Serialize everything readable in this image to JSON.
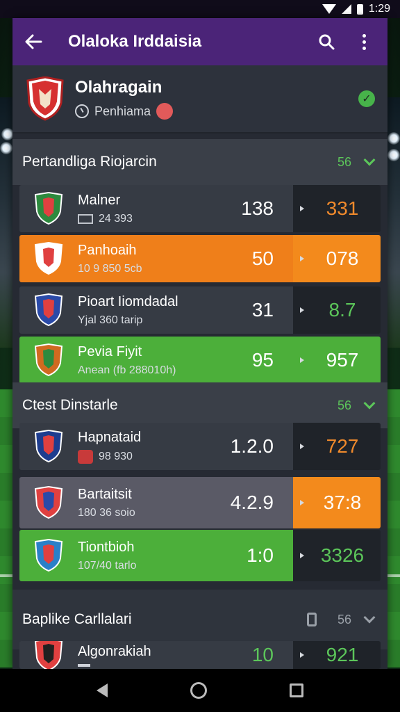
{
  "status_bar": {
    "time": "1:29"
  },
  "app_bar": {
    "title": "Olaloka Irddaisia"
  },
  "team_header": {
    "name": "Olahragain",
    "subtitle": "Penhiama"
  },
  "sections": [
    {
      "title": "Pertandliga Riojarcin",
      "count": "56",
      "rows": [
        {
          "name": "Malner",
          "sub": "24 393",
          "score": "138",
          "odds": "331",
          "style": "dark",
          "odds_color": "#f08a2c"
        },
        {
          "name": "Panhoaih",
          "sub": "10 9 850 5cb",
          "score": "50",
          "odds": "078",
          "style": "orange",
          "odds_color": "#ffffff"
        },
        {
          "name": "Pioart Iiomdadal",
          "sub": "Yjal 360 tarip",
          "score": "31",
          "odds": "8.7",
          "style": "dark",
          "odds_color": "#5cc65a"
        },
        {
          "name": "Pevia Fiyit",
          "sub": "Anean (fb 288010h)",
          "score": "95",
          "odds": "957",
          "style": "green",
          "odds_color": "#ffffff"
        }
      ]
    },
    {
      "title": "Ctest Dinstarle",
      "count": "56",
      "rows": [
        {
          "name": "Hapnataid",
          "sub": "98 930",
          "score": "1.2.0",
          "odds": "727",
          "style": "dark",
          "odds_color": "#f08a2c"
        },
        {
          "name": "Bartaitsit",
          "sub": "180 36 soio",
          "score": "4.2.9",
          "odds": "37:8",
          "style": "grey",
          "odds_color": "#ffffff"
        },
        {
          "name": "Tiontbioh",
          "sub": "107/40 tarlo",
          "score": "1:0",
          "odds": "3326",
          "style": "green",
          "odds_color": "#5cc65a"
        }
      ]
    },
    {
      "title": "Baplike Carllalari",
      "count": "56",
      "rows": [
        {
          "name": "Algonrakiah",
          "sub": "",
          "score": "10",
          "odds": "921",
          "style": "dark",
          "odds_color": "#5cc65a"
        }
      ]
    }
  ],
  "colors": {
    "app_bar": "#4b2478",
    "orange": "#ef7f1a",
    "green": "#4caf3a",
    "accent_green": "#5cc65a"
  }
}
